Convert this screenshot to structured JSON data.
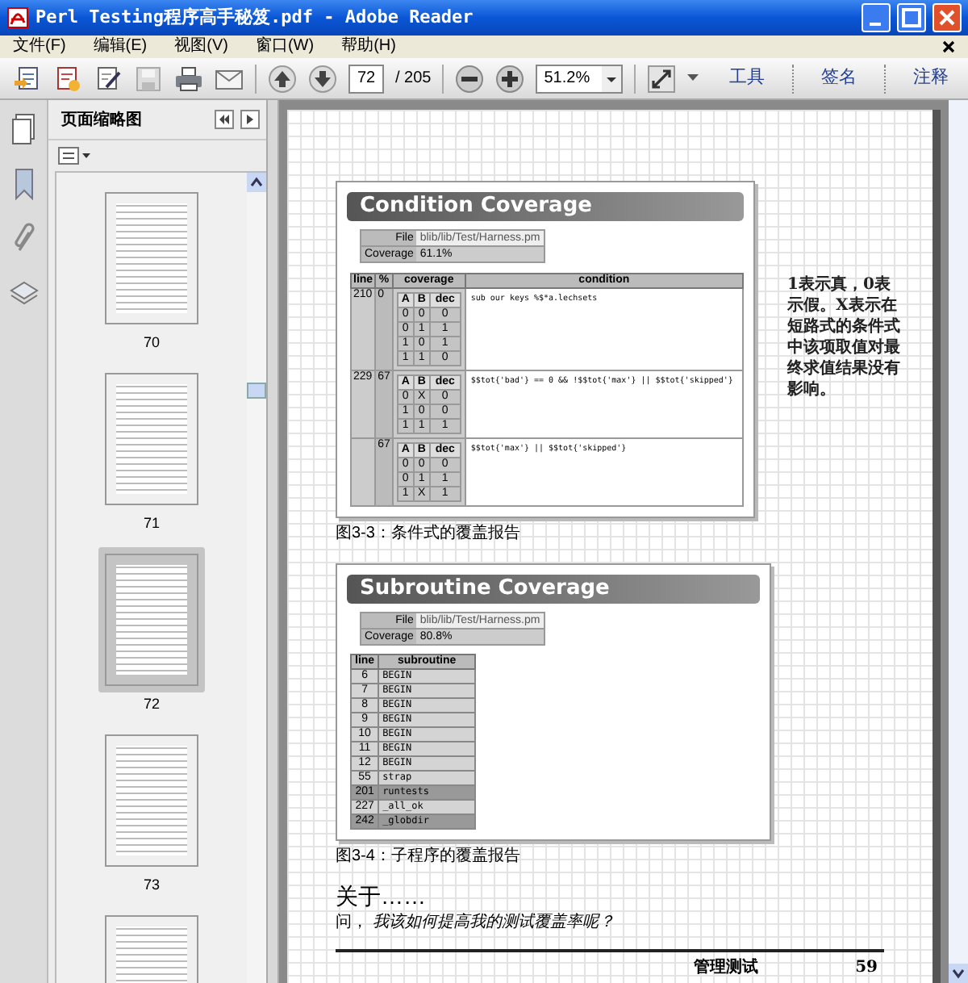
{
  "window": {
    "title": "Perl Testing程序高手秘笈.pdf - Adobe Reader"
  },
  "menu": [
    "文件(F)",
    "编辑(E)",
    "视图(V)",
    "窗口(W)",
    "帮助(H)"
  ],
  "toolbar": {
    "page": "72",
    "page_total": "/ 205",
    "zoom": "51.2%",
    "panels": [
      "工具",
      "签名",
      "注释"
    ]
  },
  "sidebar": {
    "title": "页面缩略图",
    "thumbnails": [
      {
        "label": "70",
        "selected": false
      },
      {
        "label": "71",
        "selected": false
      },
      {
        "label": "72",
        "selected": true
      },
      {
        "label": "73",
        "selected": false
      },
      {
        "selected": false
      }
    ]
  },
  "document": {
    "condition_report": {
      "title": "Condition Coverage",
      "file_label": "File",
      "file": "blib/lib/Test/Harness.pm",
      "coverage_label": "Coverage",
      "coverage": "61.1%",
      "columns": [
        "line",
        "%",
        "coverage",
        "condition"
      ],
      "rows": [
        {
          "line": "210",
          "percent": "0",
          "truth_columns": [
            "A",
            "B",
            "dec"
          ],
          "truth": [
            [
              "0",
              "0",
              "0"
            ],
            [
              "0",
              "1",
              "1"
            ],
            [
              "1",
              "0",
              "1"
            ],
            [
              "1",
              "1",
              "0"
            ]
          ],
          "condition": "sub our keys %$*a.lechsets"
        },
        {
          "line": "229",
          "percent": "67",
          "truth_columns": [
            "A",
            "B",
            "dec"
          ],
          "truth": [
            [
              "0",
              "X",
              "0"
            ],
            [
              "1",
              "0",
              "0"
            ],
            [
              "1",
              "1",
              "1"
            ]
          ],
          "condition": "$$tot{'bad'} == 0 && !$$tot{'max'} || $$tot{'skipped'}"
        },
        {
          "line": "",
          "percent": "67",
          "truth_columns": [
            "A",
            "B",
            "dec"
          ],
          "truth": [
            [
              "0",
              "0",
              "0"
            ],
            [
              "0",
              "1",
              "1"
            ],
            [
              "1",
              "X",
              "1"
            ]
          ],
          "condition": "$$tot{'max'} || $$tot{'skipped'}"
        }
      ]
    },
    "note": "1表示真，0表示假。X表示在短路式的条件式中该项取值对最终求值结果没有影响。",
    "caption_1": "图3-3：条件式的覆盖报告",
    "subroutine_report": {
      "title": "Subroutine Coverage",
      "file_label": "File",
      "file": "blib/lib/Test/Harness.pm",
      "coverage_label": "Coverage",
      "coverage": "80.8%",
      "columns": [
        "line",
        "subroutine"
      ],
      "rows": [
        {
          "line": "6",
          "name": "BEGIN",
          "covered": true
        },
        {
          "line": "7",
          "name": "BEGIN",
          "covered": true
        },
        {
          "line": "8",
          "name": "BEGIN",
          "covered": true
        },
        {
          "line": "9",
          "name": "BEGIN",
          "covered": true
        },
        {
          "line": "10",
          "name": "BEGIN",
          "covered": true
        },
        {
          "line": "11",
          "name": "BEGIN",
          "covered": true
        },
        {
          "line": "12",
          "name": "BEGIN",
          "covered": true
        },
        {
          "line": "55",
          "name": "strap",
          "covered": true
        },
        {
          "line": "201",
          "name": "runtests",
          "covered": false
        },
        {
          "line": "227",
          "name": "_all_ok",
          "covered": true
        },
        {
          "line": "242",
          "name": "_globdir",
          "covered": false
        }
      ]
    },
    "caption_2": "图3-4：子程序的覆盖报告",
    "section_heading": "关于……",
    "question": "问， *我该如何提高我的测试覆盖率呢？*",
    "footer": {
      "chapter": "管理测试",
      "page": "59"
    }
  }
}
